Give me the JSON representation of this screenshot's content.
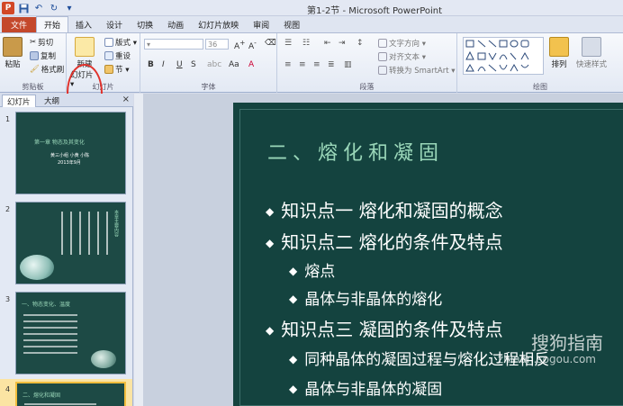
{
  "window": {
    "title": "第1-2节 - Microsoft PowerPoint",
    "logo": "P",
    "qat": [
      "save-icon",
      "undo-icon",
      "redo-icon",
      "customize-icon"
    ]
  },
  "tabs": [
    "文件",
    "开始",
    "插入",
    "设计",
    "切换",
    "动画",
    "幻灯片放映",
    "审阅",
    "视图"
  ],
  "ribbon": {
    "clipboard": {
      "label": "剪贴板",
      "paste": "粘贴",
      "cut": "剪切",
      "copy": "复制",
      "format": "格式刷"
    },
    "slides": {
      "label": "幻灯片",
      "new_slide": "新建",
      "new_slide2": "幻灯片 ▾",
      "layout": "版式 ▾",
      "reset": "重设",
      "section": "节 ▾"
    },
    "font": {
      "label": "字体",
      "font_size": "36",
      "bold": "B",
      "italic": "I",
      "underline": "U",
      "strike": "S"
    },
    "paragraph": {
      "label": "段落",
      "text_dir": "文字方向 ▾",
      "align_text": "对齐文本 ▾",
      "smartart": "转换为 SmartArt ▾"
    },
    "drawing": {
      "label": "绘图",
      "arrange": "排列",
      "quick_styles": "快速样式"
    }
  },
  "panel": {
    "tab_slides": "幻灯片",
    "tab_outline": "大纲",
    "close": "×",
    "thumbs": [
      {
        "num": "1",
        "title": "第一章  物态及其变化",
        "sub1": "黄三小组 小黄 小陈",
        "sub2": "2013年9月"
      },
      {
        "num": "2",
        "side": "本章主要内容"
      },
      {
        "num": "3",
        "title": "一、物态变化、温度"
      },
      {
        "num": "4",
        "title": "二、熔化和凝固"
      }
    ]
  },
  "slide": {
    "title": "二、熔化和凝固",
    "bullets": [
      {
        "level": 1,
        "text": "知识点一 熔化和凝固的概念"
      },
      {
        "level": 1,
        "text": "知识点二 熔化的条件及特点"
      },
      {
        "level": 2,
        "text": "熔点"
      },
      {
        "level": 2,
        "text": "晶体与非晶体的熔化"
      },
      {
        "level": 1,
        "text": "知识点三 凝固的条件及特点"
      },
      {
        "level": 2,
        "text": "同种晶体的凝固过程与熔化过程相反"
      },
      {
        "level": 2,
        "text": "晶体与非晶体的凝固"
      }
    ]
  },
  "watermark": {
    "line1": "搜狗指南",
    "line2": "zhinan.sogou.com"
  }
}
